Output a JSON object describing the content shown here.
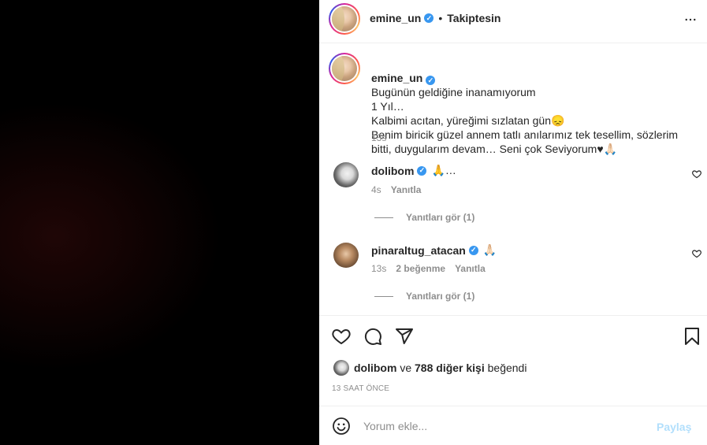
{
  "header": {
    "username": "emine_un",
    "separator": "•",
    "follow_status": "Takiptesin",
    "more_icon": "more-horizontal-icon"
  },
  "caption": {
    "username": "emine_un",
    "text": "Bugünün geldiğine inanamıyorum\n1 Yıl…\nKalbimi acıtan, yüreğimi sızlatan gün😞\nBenim biricik güzel annem tatlı anılarımız tek tesellim, sözlerim bitti, duygularım devam… Seni çok Seviyorum♥🙏🏻",
    "time": "13s"
  },
  "comments": [
    {
      "username": "dolibom",
      "text": "🙏…",
      "time": "4s",
      "likes": "",
      "reply_label": "Yanıtla",
      "view_replies": "Yanıtları gör (1)"
    },
    {
      "username": "pinaraltug_atacan",
      "text": "🙏🏻",
      "time": "13s",
      "likes": "2 beğenme",
      "reply_label": "Yanıtla",
      "view_replies": "Yanıtları gör (1)"
    }
  ],
  "actions": {
    "like_icon": "heart-icon",
    "comment_icon": "comment-icon",
    "share_icon": "send-icon",
    "save_icon": "bookmark-icon"
  },
  "likes": {
    "first_user": "dolibom",
    "connector": "ve",
    "others": "788 diğer kişi",
    "suffix": "beğendi"
  },
  "post_time": "13 SAAT ÖNCE",
  "comment_box": {
    "emoji_icon": "smiley-icon",
    "placeholder": "Yorum ekle...",
    "post_label": "Paylaş"
  },
  "colors": {
    "verified": "#3897f0",
    "post_button_disabled": "#b2dffc",
    "muted_text": "#8e8e8e"
  }
}
